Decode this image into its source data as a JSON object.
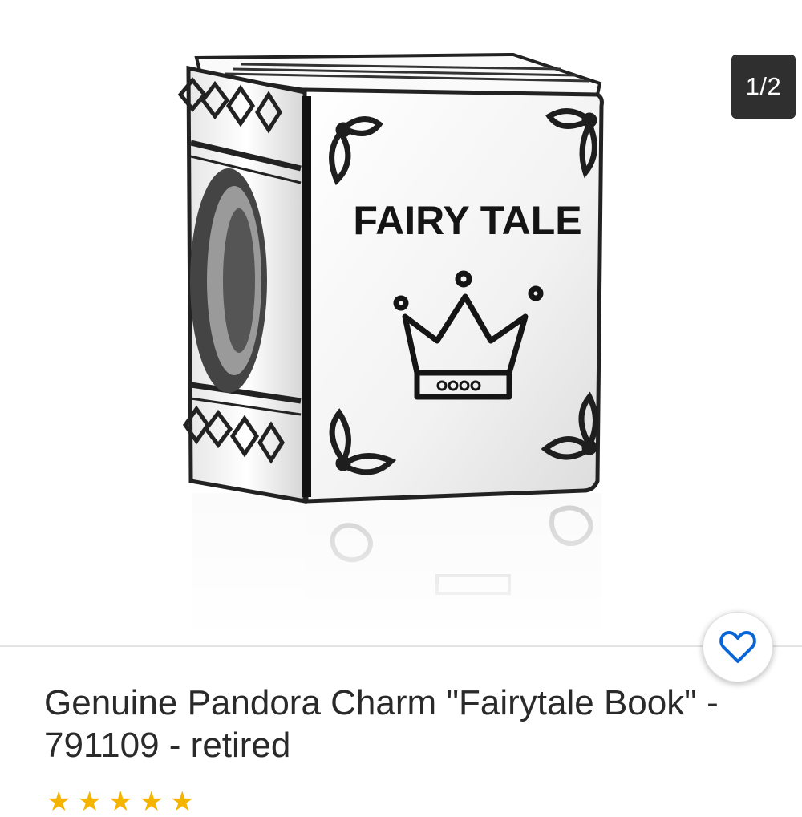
{
  "gallery": {
    "counter": "1/2",
    "image_text": "FAIRY TALE"
  },
  "product": {
    "title": "Genuine Pandora Charm \"Fairytale Book\" - 791109 - retired",
    "rating_stars": [
      "★",
      "★",
      "★",
      "★",
      "★"
    ]
  },
  "icons": {
    "favorite": "heart-outline-icon",
    "rating": "star-icon"
  },
  "colors": {
    "accent": "#0a66d6",
    "counter_bg": "#2f2f2f",
    "star": "#f4b400"
  }
}
